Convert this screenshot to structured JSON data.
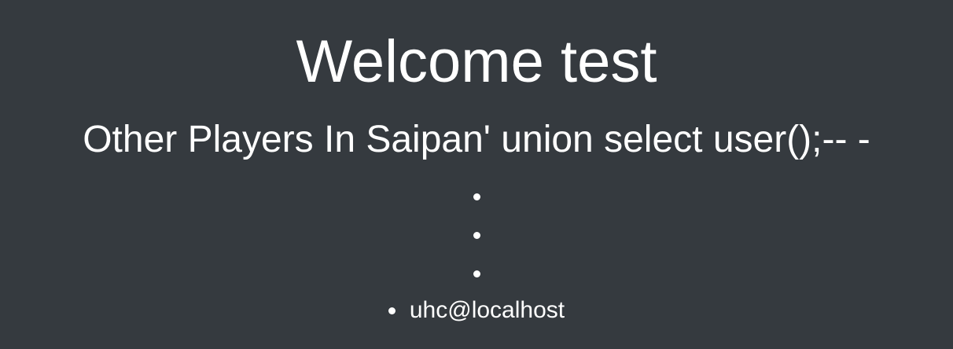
{
  "heading": {
    "welcome": "Welcome test",
    "subtitle": "Other Players In Saipan' union select user();-- -"
  },
  "players": [
    {
      "name": ""
    },
    {
      "name": ""
    },
    {
      "name": ""
    },
    {
      "name": "uhc@localhost"
    }
  ],
  "colors": {
    "background": "#353a3f",
    "text": "#ffffff"
  }
}
